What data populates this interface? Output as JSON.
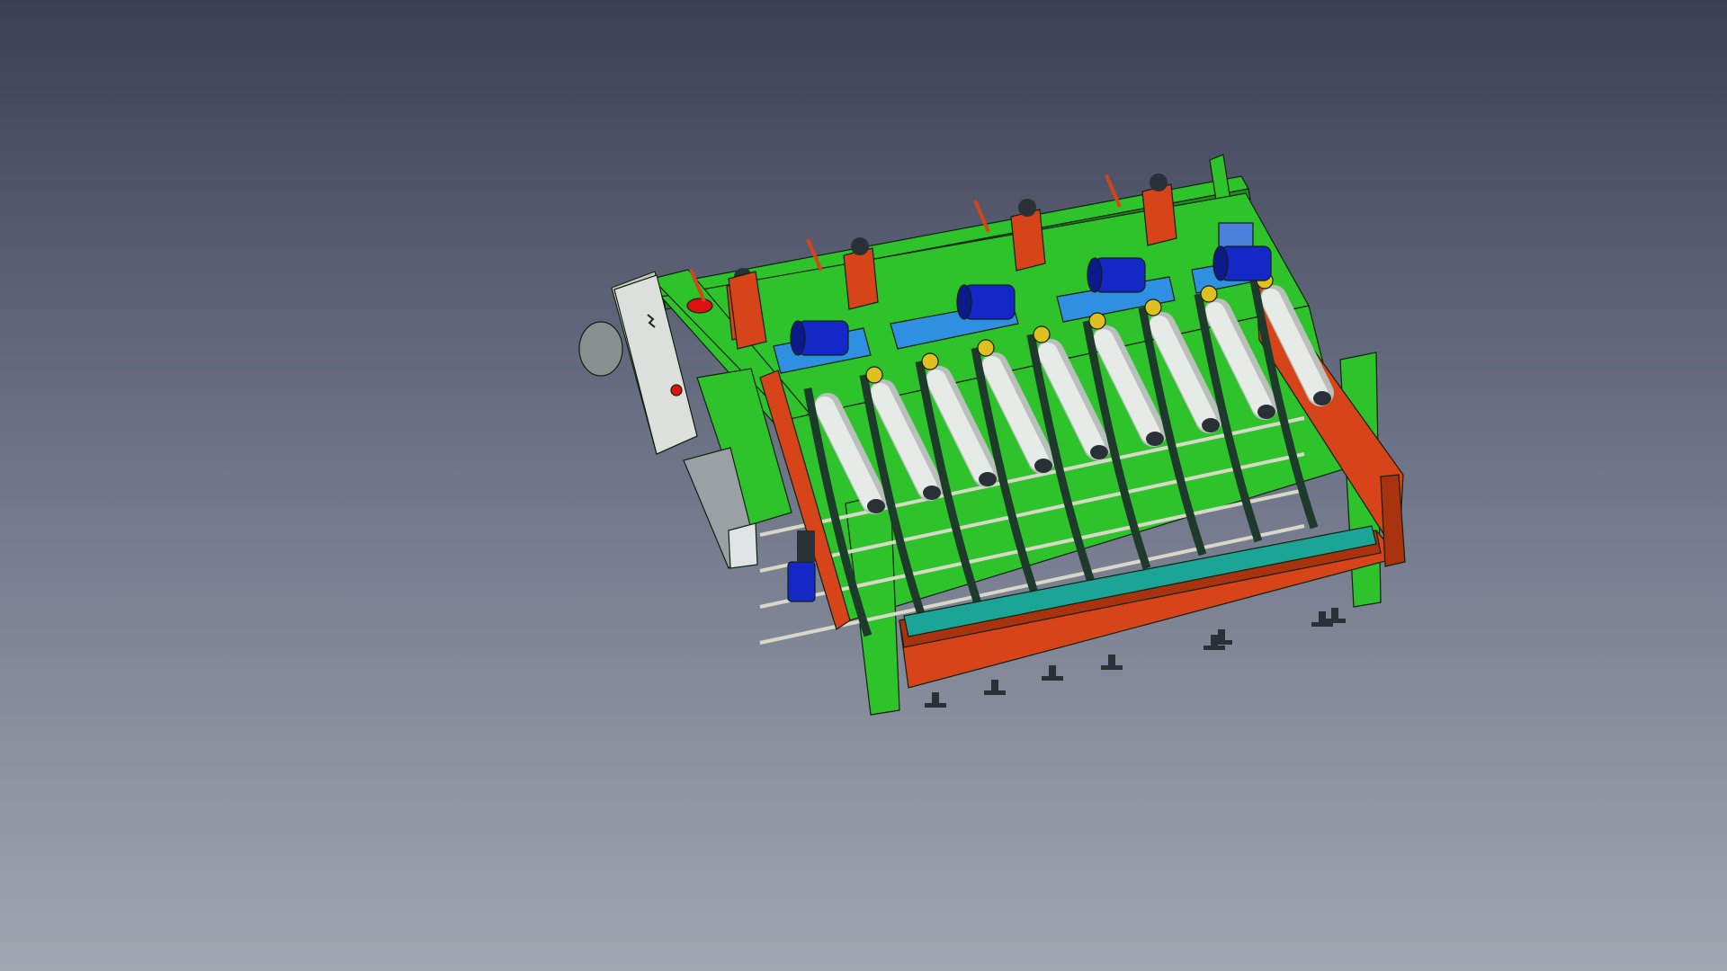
{
  "app": {
    "viewport_label": "",
    "background_top_color": "#3b3f55",
    "background_bottom_color": "#a2a6b1"
  },
  "model": {
    "colors": {
      "frame_green": "#2ec22b",
      "frame_green_dark": "#1f8f1c",
      "guard_orange": "#d7441a",
      "guard_orange_dark": "#a9320f",
      "roller_white": "#e7ebe7",
      "roller_shadow": "#b9c0bc",
      "motor_blue": "#1428c8",
      "conveyor_blue": "#2f8fe0",
      "cabinet_gray": "#dcdfdb",
      "teal_plate": "#1aa597",
      "dark_parts": "#2a3136",
      "red_button": "#e01010",
      "yellow_sprocket": "#e0c020"
    },
    "counts": {
      "rollers": 9,
      "motors": 4,
      "carriages": 5,
      "feet": 8
    }
  }
}
